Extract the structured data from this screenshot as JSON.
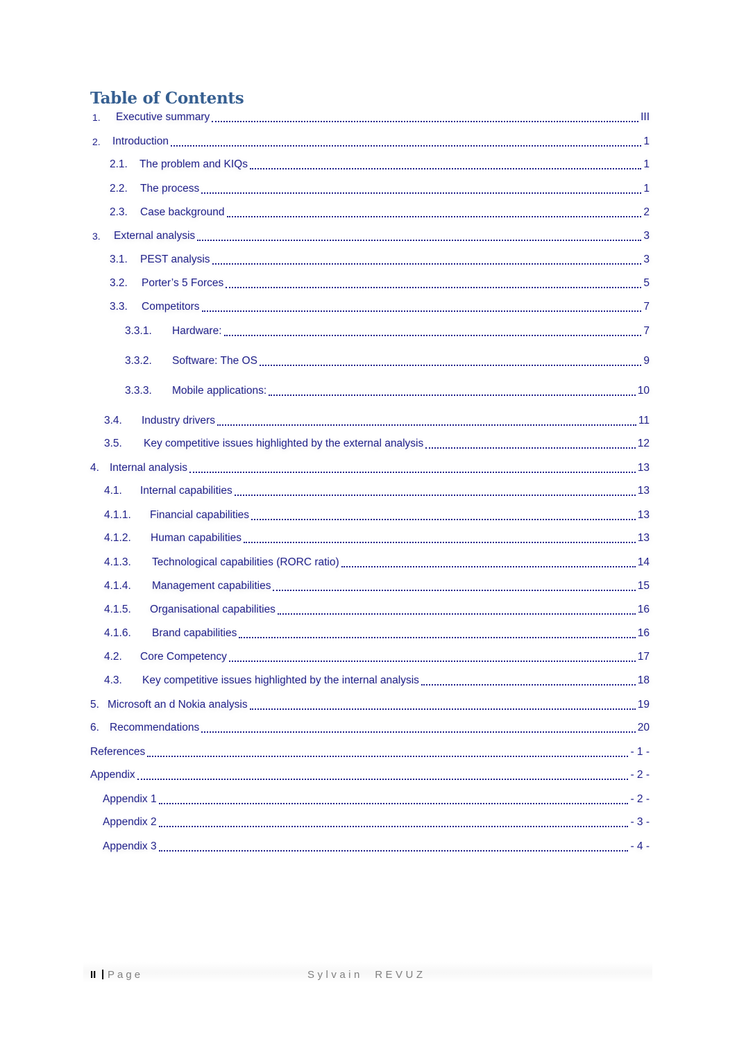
{
  "document": {
    "toc_heading": "Table of Contents",
    "entries": [
      {
        "number": "1.",
        "label": "Executive summary",
        "page": "III"
      },
      {
        "number": "2.",
        "label": "Introduction",
        "page": "1"
      },
      {
        "number": "2.1.",
        "label": "The problem and KIQs",
        "page": "1"
      },
      {
        "number": "2.2.",
        "label": "The process",
        "page": "1"
      },
      {
        "number": "2.3.",
        "label": "Case background",
        "page": "2"
      },
      {
        "number": "3.",
        "label": "External analysis",
        "page": "3"
      },
      {
        "number": "3.1.",
        "label": "PEST analysis",
        "page": "3"
      },
      {
        "number": "3.2.",
        "label": "Porter’s 5 Forces",
        "page": "5"
      },
      {
        "number": "3.3.",
        "label": "Competitors",
        "page": "7"
      },
      {
        "number": "3.3.1.",
        "label": "Hardware:",
        "page": "7"
      },
      {
        "number": "3.3.2.",
        "label": "Software: The OS",
        "page": "9"
      },
      {
        "number": "3.3.3.",
        "label": "Mobile applications:",
        "page": "10"
      },
      {
        "number": "3.4.",
        "label": "Industry drivers",
        "page": "11"
      },
      {
        "number": "3.5.",
        "label": "Key competitive issues highlighted by the external analysis",
        "page": "12"
      },
      {
        "number": "4.",
        "label": "Internal analysis",
        "page": "13"
      },
      {
        "number": "4.1.",
        "label": "Internal capabilities",
        "page": "13"
      },
      {
        "number": "4.1.1.",
        "label": "Financial capabilities",
        "page": "13"
      },
      {
        "number": "4.1.2.",
        "label": "Human capabilities",
        "page": "13"
      },
      {
        "number": "4.1.3.",
        "label": "Technological capabilities (RORC ratio)",
        "page": "14"
      },
      {
        "number": "4.1.4.",
        "label": "Management capabilities",
        "page": "15"
      },
      {
        "number": "4.1.5.",
        "label": "Organisational capabilities",
        "page": "16"
      },
      {
        "number": "4.1.6.",
        "label": "Brand capabilities",
        "page": "16"
      },
      {
        "number": "4.2.",
        "label": "Core Competency",
        "page": "17"
      },
      {
        "number": "4.3.",
        "label": "Key competitive issues highlighted by the internal analysis",
        "page": "18"
      },
      {
        "number": "5.",
        "label": "Microsoft an d Nokia analysis",
        "page": "19"
      },
      {
        "number": "6.",
        "label": "Recommendations",
        "page": "20"
      },
      {
        "number": "",
        "label": "References",
        "page": "- 1 -"
      },
      {
        "number": "",
        "label": "Appendix",
        "page": "- 2 -"
      },
      {
        "number": "",
        "label": "Appendix 1",
        "page": "- 2 -"
      },
      {
        "number": "",
        "label": "Appendix 2",
        "page": "- 3 -"
      },
      {
        "number": "",
        "label": "Appendix 3",
        "page": "- 4 -"
      }
    ]
  },
  "footer": {
    "page_number": "II",
    "separator": "|",
    "page_word": "Page",
    "author": "Sylvain  REVUZ"
  },
  "colors": {
    "heading": "#365f91",
    "toc_text": "#1f1f8a",
    "footer_text": "#808080"
  }
}
